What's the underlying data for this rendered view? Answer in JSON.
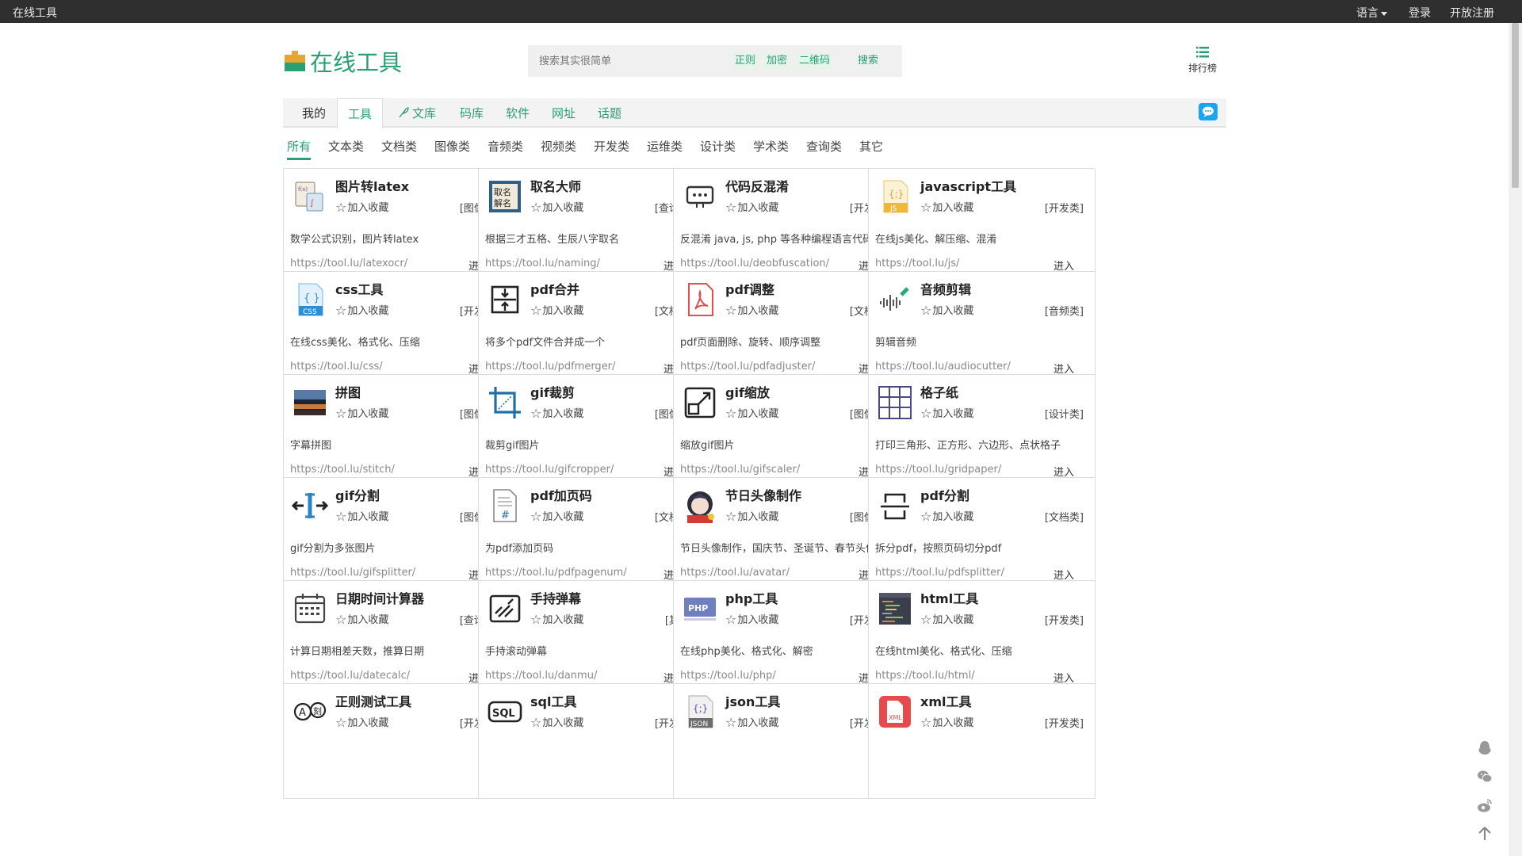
{
  "topbar": {
    "brand": "在线工具",
    "language": "语言",
    "login": "登录",
    "register": "开放注册"
  },
  "header": {
    "logo_text": "在线工具",
    "search_placeholder": "搜索其实很简单",
    "tags": [
      "正则",
      "加密",
      "二维码"
    ],
    "search_button": "搜索",
    "rank_label": "排行榜"
  },
  "main_tabs": [
    "我的",
    "工具",
    "文库",
    "码库",
    "软件",
    "网址",
    "话题"
  ],
  "active_main_tab": "工具",
  "sub_tabs": [
    "所有",
    "文本类",
    "文档类",
    "图像类",
    "音频类",
    "视频类",
    "开发类",
    "运维类",
    "设计类",
    "学术类",
    "查询类",
    "其它"
  ],
  "active_sub_tab": "所有",
  "fav_label": "加入收藏",
  "enter_label": "进入",
  "cards": [
    {
      "icon": "formula-to-latex-icon",
      "name": "图片转latex",
      "category": "[图像类]",
      "desc": "数学公式识别，图片转latex",
      "url": "https://tool.lu/latexocr/"
    },
    {
      "icon": "naming-icon",
      "name": "取名大师",
      "category": "[查询类]",
      "desc": "根据三才五格、生辰八字取名",
      "url": "https://tool.lu/naming/"
    },
    {
      "icon": "deobfuscation-icon",
      "name": "代码反混淆",
      "category": "[开发类]",
      "desc": "反混淆 java, js, php 等各种编程语言代码",
      "url": "https://tool.lu/deobfuscation/"
    },
    {
      "icon": "js-file-icon",
      "name": "javascript工具",
      "category": "[开发类]",
      "desc": "在线js美化、解压缩、混淆",
      "url": "https://tool.lu/js/"
    },
    {
      "icon": "css-file-icon",
      "name": "css工具",
      "category": "[开发类]",
      "desc": "在线css美化、格式化、压缩",
      "url": "https://tool.lu/css/"
    },
    {
      "icon": "pdf-merge-icon",
      "name": "pdf合并",
      "category": "[文档类]",
      "desc": "将多个pdf文件合并成一个",
      "url": "https://tool.lu/pdfmerger/"
    },
    {
      "icon": "pdf-adjust-icon",
      "name": "pdf调整",
      "category": "[文档类]",
      "desc": "pdf页面删除、旋转、顺序调整",
      "url": "https://tool.lu/pdfadjuster/"
    },
    {
      "icon": "audio-cut-icon",
      "name": "音频剪辑",
      "category": "[音频类]",
      "desc": "剪辑音频",
      "url": "https://tool.lu/audiocutter/"
    },
    {
      "icon": "stitch-image-icon",
      "name": "拼图",
      "category": "[图像类]",
      "desc": "字幕拼图",
      "url": "https://tool.lu/stitch/"
    },
    {
      "icon": "crop-icon",
      "name": "gif裁剪",
      "category": "[图像类]",
      "desc": "裁剪gif图片",
      "url": "https://tool.lu/gifcropper/"
    },
    {
      "icon": "scale-icon",
      "name": "gif缩放",
      "category": "[图像类]",
      "desc": "缩放gif图片",
      "url": "https://tool.lu/gifscaler/"
    },
    {
      "icon": "grid-paper-icon",
      "name": "格子纸",
      "category": "[设计类]",
      "desc": "打印三角形、正方形、六边形、点状格子",
      "url": "https://tool.lu/gridpaper/"
    },
    {
      "icon": "split-icon",
      "name": "gif分割",
      "category": "[图像类]",
      "desc": "gif分割为多张图片",
      "url": "https://tool.lu/gifsplitter/"
    },
    {
      "icon": "page-number-icon",
      "name": "pdf加页码",
      "category": "[文档类]",
      "desc": "为pdf添加页码",
      "url": "https://tool.lu/pdfpagenum/"
    },
    {
      "icon": "avatar-icon",
      "name": "节日头像制作",
      "category": "[图像类]",
      "desc": "节日头像制作，国庆节、圣诞节、春节头像",
      "url": "https://tool.lu/avatar/"
    },
    {
      "icon": "pdf-split-icon",
      "name": "pdf分割",
      "category": "[文档类]",
      "desc": "拆分pdf，按照页码切分pdf",
      "url": "https://tool.lu/pdfsplitter/"
    },
    {
      "icon": "calendar-icon",
      "name": "日期时间计算器",
      "category": "[查询类]",
      "desc": "计算日期相差天数，推算日期",
      "url": "https://tool.lu/datecalc/"
    },
    {
      "icon": "danmu-icon",
      "name": "手持弹幕",
      "category": "[其它]",
      "desc": "手持滚动弹幕",
      "url": "https://tool.lu/danmu/"
    },
    {
      "icon": "php-icon",
      "name": "php工具",
      "category": "[开发类]",
      "desc": "在线php美化、格式化、解密",
      "url": "https://tool.lu/php/"
    },
    {
      "icon": "html-code-icon",
      "name": "html工具",
      "category": "[开发类]",
      "desc": "在线html美化、格式化、压缩",
      "url": "https://tool.lu/html/"
    },
    {
      "icon": "regex-icon",
      "name": "正则测试工具",
      "category": "[开发类]",
      "desc": "",
      "url": ""
    },
    {
      "icon": "sql-icon",
      "name": "sql工具",
      "category": "[开发类]",
      "desc": "",
      "url": ""
    },
    {
      "icon": "json-file-icon",
      "name": "json工具",
      "category": "[开发类]",
      "desc": "",
      "url": ""
    },
    {
      "icon": "xml-file-icon",
      "name": "xml工具",
      "category": "[开发类]",
      "desc": "",
      "url": ""
    }
  ],
  "side_icons": [
    "qq-icon",
    "wechat-icon",
    "weibo-icon",
    "back-to-top-icon"
  ],
  "colors": {
    "accent": "#2a9f74",
    "topbar": "#2f2f2f",
    "chat": "#1aa4f2"
  }
}
